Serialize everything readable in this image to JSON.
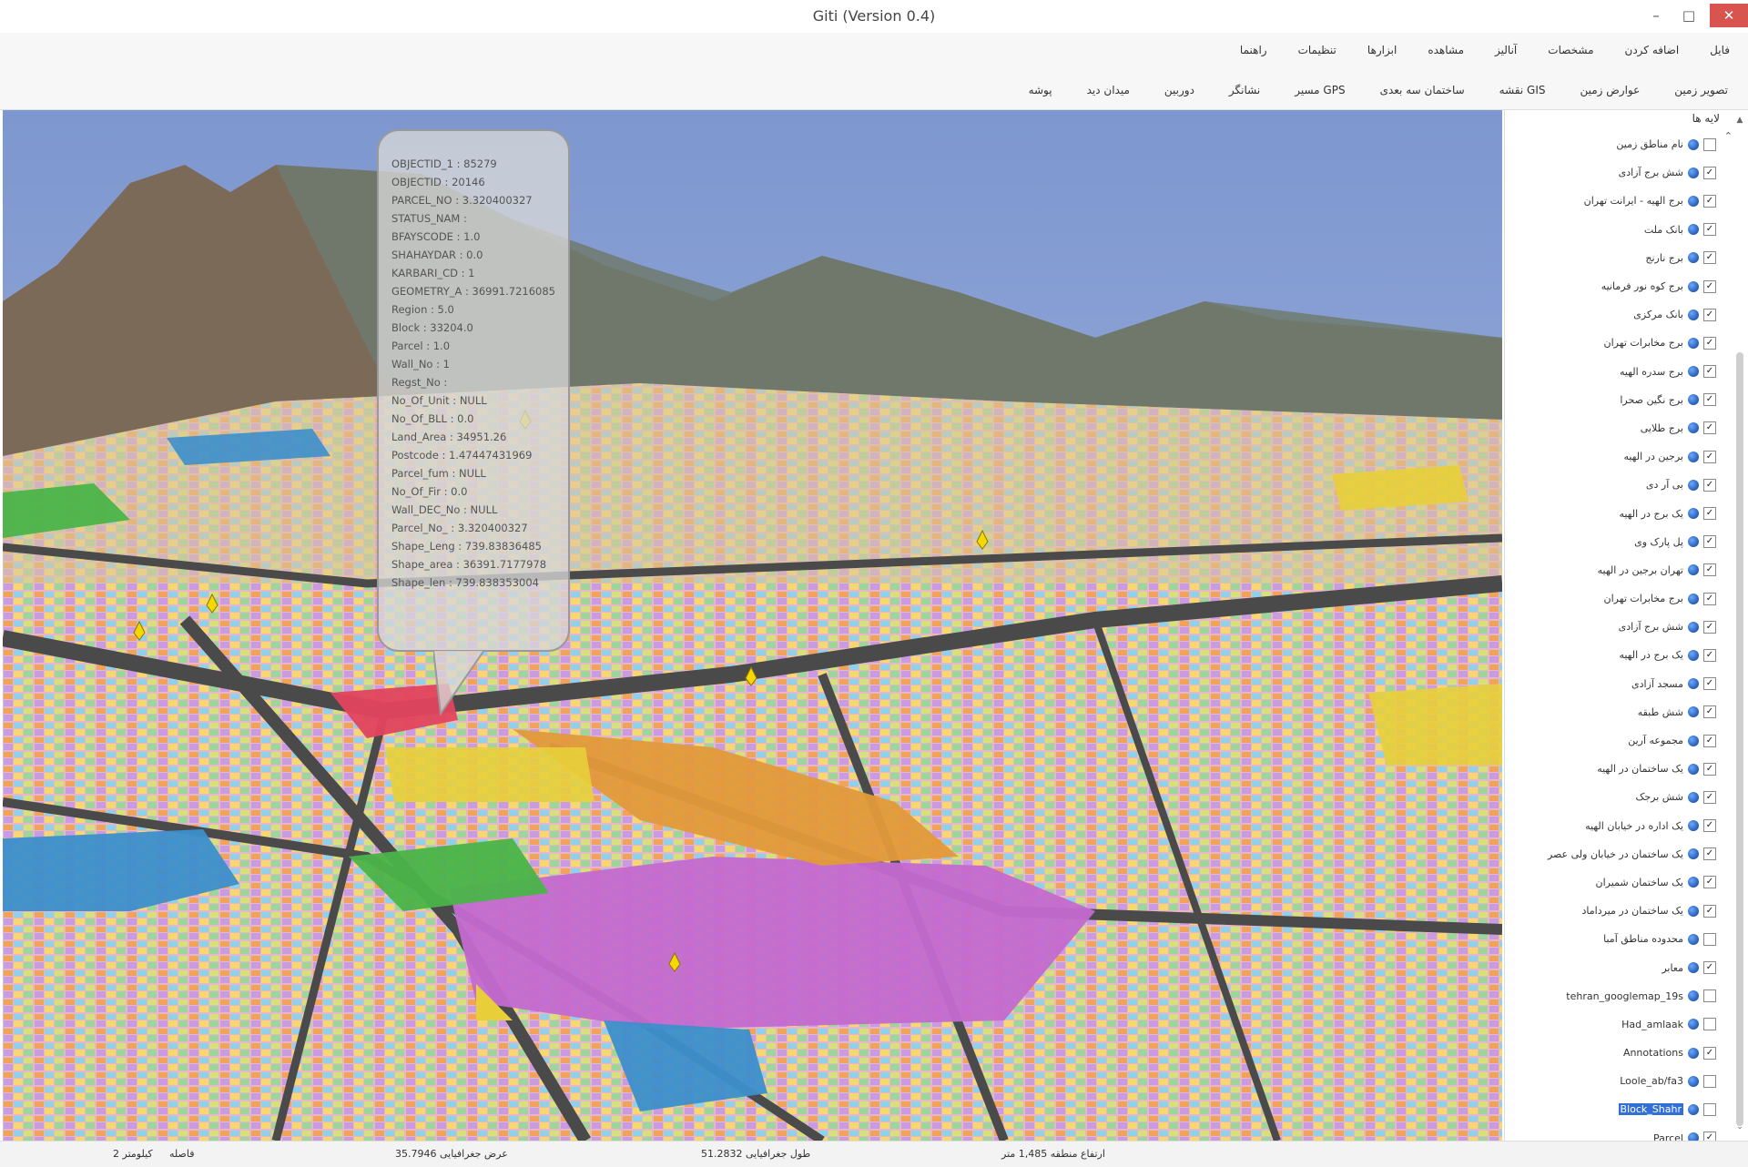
{
  "window": {
    "title": "Giti (Version 0.4)",
    "minimize_glyph": "–",
    "maximize_glyph": "□",
    "close_glyph": "✕"
  },
  "menu": [
    "فایل",
    "اضافه کردن",
    "مشخصات",
    "آنالیز",
    "مشاهده",
    "ابزارها",
    "تنظیمات",
    "راهنما"
  ],
  "toolbar": [
    "تصویر زمین",
    "عوارض زمین",
    "نقشه GIS",
    "ساختمان سه بعدی",
    "مسیر GPS",
    "نشانگر",
    "دوربین",
    "میدان دید",
    "پوشه"
  ],
  "callout_lines": [
    "OBJECTID_1 : 85279",
    "OBJECTID : 20146",
    "PARCEL_NO : 3.320400327",
    "STATUS_NAM :",
    "BFAYSCODE : 1.0",
    "SHAHAYDAR : 0.0",
    "KARBARI_CD : 1",
    "GEOMETRY_A : 36991.7216085",
    "Region : 5.0",
    "Block : 33204.0",
    "Parcel : 1.0",
    "Wall_No : 1",
    "Regst_No :",
    "No_Of_Unit : NULL",
    "No_Of_BLL : 0.0",
    "Land_Area : 34951.26",
    "Postcode : 1.47447431969",
    "Parcel_fum : NULL",
    "No_Of_Fir : 0.0",
    "Wall_DEC_No : NULL",
    "Parcel_No_ : 3.320400327",
    "Shape_Leng : 739.83836485",
    "Shape_area : 36391.7177978",
    "Shape_len : 739.838353004"
  ],
  "layers_panel": {
    "header": "لایه ها",
    "collapse_glyph": "⌃",
    "scroll_up_glyph": "▲",
    "scroll_down_glyph": "⌄",
    "check_glyph": "✓",
    "items": [
      {
        "label": "نام مناطق زمین",
        "checked": false
      },
      {
        "label": "شش برج آزادی",
        "checked": true
      },
      {
        "label": "برج الهیه - ایرانت تهران",
        "checked": true
      },
      {
        "label": "بانک ملت",
        "checked": true
      },
      {
        "label": "برج نارنج",
        "checked": true
      },
      {
        "label": "برج کوه نور فرمانیه",
        "checked": true
      },
      {
        "label": "بانک مرکزی",
        "checked": true
      },
      {
        "label": "برج مخابرات تهران",
        "checked": true
      },
      {
        "label": "برج سدره الهیه",
        "checked": true
      },
      {
        "label": "برج نگین صحرا",
        "checked": true
      },
      {
        "label": "برج طلایی",
        "checked": true
      },
      {
        "label": "برجین در الهیه",
        "checked": true
      },
      {
        "label": "بی آر دی",
        "checked": true
      },
      {
        "label": "یک برج در الهیه",
        "checked": true
      },
      {
        "label": "پل پارک وی",
        "checked": true
      },
      {
        "label": "تهران برجین در الهیه",
        "checked": true
      },
      {
        "label": "برج مخابرات تهران",
        "checked": true
      },
      {
        "label": "شش برج آزادی",
        "checked": true
      },
      {
        "label": "یک برج در الهیه",
        "checked": true
      },
      {
        "label": "مسجد آزادی",
        "checked": true
      },
      {
        "label": "شش طبقه",
        "checked": true
      },
      {
        "label": "مجموعه آرین",
        "checked": true
      },
      {
        "label": "یک ساختمان در الهیه",
        "checked": true
      },
      {
        "label": "شش برجک",
        "checked": true
      },
      {
        "label": "یک اداره در خیابان الهیه",
        "checked": true
      },
      {
        "label": "یک ساختمان در خیابان ولی عصر",
        "checked": true
      },
      {
        "label": "یک ساختمان شمیران",
        "checked": true
      },
      {
        "label": "یک ساختمان در میرداماد",
        "checked": true
      },
      {
        "label": "محدوده مناطق آمبا",
        "checked": false
      },
      {
        "label": "معابر",
        "checked": true
      },
      {
        "label": "tehran_googlemap_19s",
        "checked": false
      },
      {
        "label": "Had_amlaak",
        "checked": false
      },
      {
        "label": "Annotations",
        "checked": true
      },
      {
        "label": "Loole_ab/fa3",
        "checked": false
      },
      {
        "label": "Block_Shahr",
        "checked": false,
        "selected": true
      },
      {
        "label": "Parcel",
        "checked": true
      }
    ]
  },
  "status": {
    "scale": "2 کیلومتر",
    "scale_label": "فاصله",
    "latitude": "عرض جغرافیایی 35.7946",
    "longitude": "طول جغرافیایی 51.2832",
    "altitude": "ارتفاع منطقه 1,485 متر"
  },
  "colors": {
    "sky_top": "#7d97cf",
    "sky_bottom": "#aebde3",
    "road": "#4a4a4a",
    "parcel_purple": "#c46ad0",
    "parcel_orange": "#e39a3a",
    "parcel_blue": "#3d8fcc",
    "parcel_green": "#4ab449",
    "parcel_red": "#e2435d",
    "parcel_yellow": "#e8cf3a",
    "selection_blue": "#3370d6"
  }
}
